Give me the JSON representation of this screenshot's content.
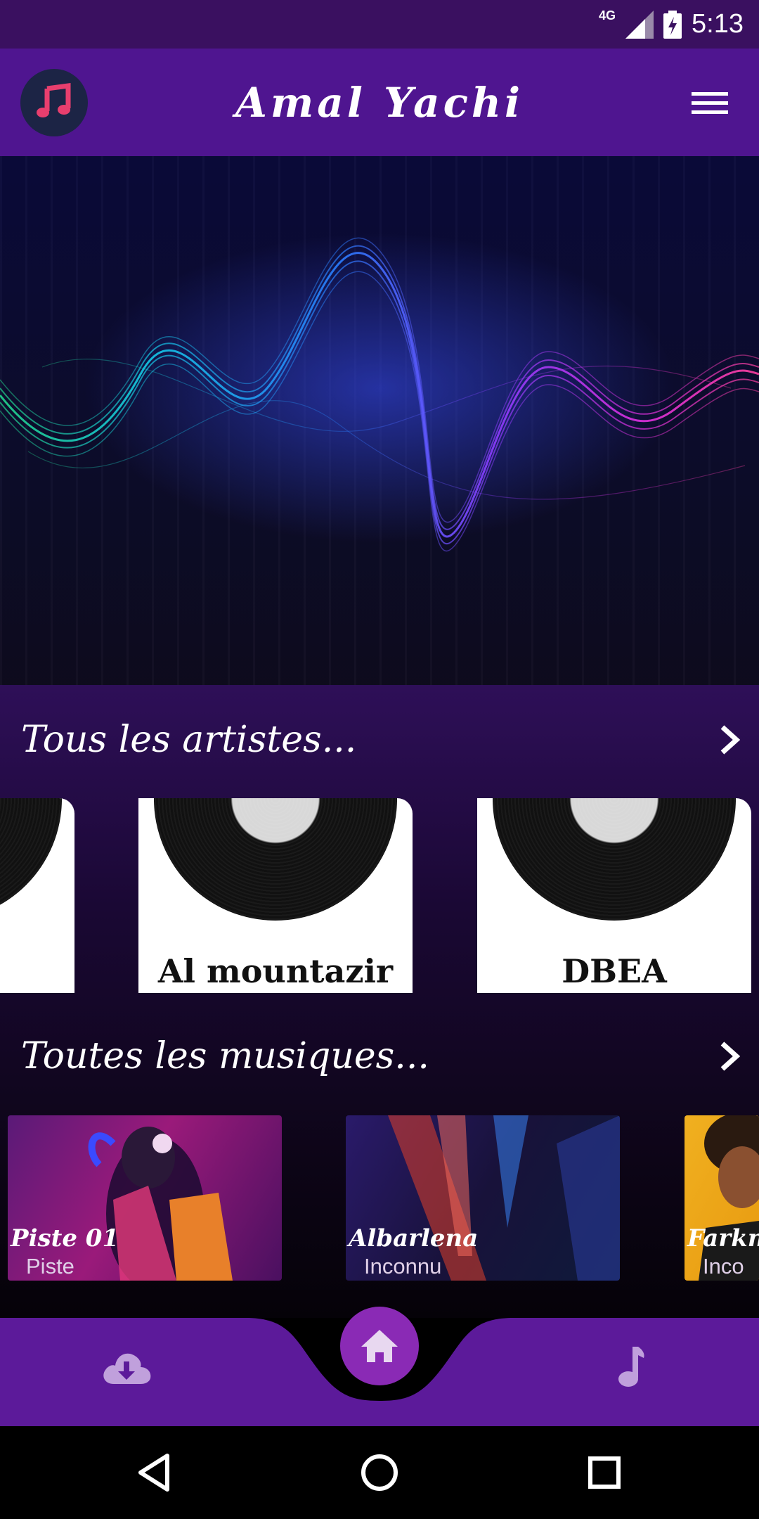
{
  "status": {
    "network": "4G",
    "time": "5:13"
  },
  "app_bar": {
    "title": "Amal Yachi",
    "logo_icon": "music-note-icon",
    "menu_icon": "hamburger-menu-icon"
  },
  "colors": {
    "app_bar": "#4f1590",
    "status_bar": "#3a1060",
    "nav_bar": "#5c1a9a",
    "home_button": "#8a2ab5",
    "logo_bg": "#1c2445",
    "logo_note": "#e83e6e"
  },
  "artists_section": {
    "title": "Tous les artistes...",
    "artists": [
      {
        "name": ""
      },
      {
        "name": "Al mountazir"
      },
      {
        "name": "DBEA"
      }
    ]
  },
  "music_section": {
    "title": "Toutes les musiques...",
    "tracks": [
      {
        "title": "Piste 01",
        "subtitle": "Piste"
      },
      {
        "title": "Albarlena",
        "subtitle": "Inconnu"
      },
      {
        "title": "Farkne",
        "subtitle": "Inco"
      }
    ]
  },
  "bottom_nav": {
    "left_icon": "cloud-download-icon",
    "center_icon": "home-icon",
    "right_icon": "music-note-icon"
  },
  "system_nav": [
    "back-icon",
    "home-circle-icon",
    "recents-icon"
  ]
}
